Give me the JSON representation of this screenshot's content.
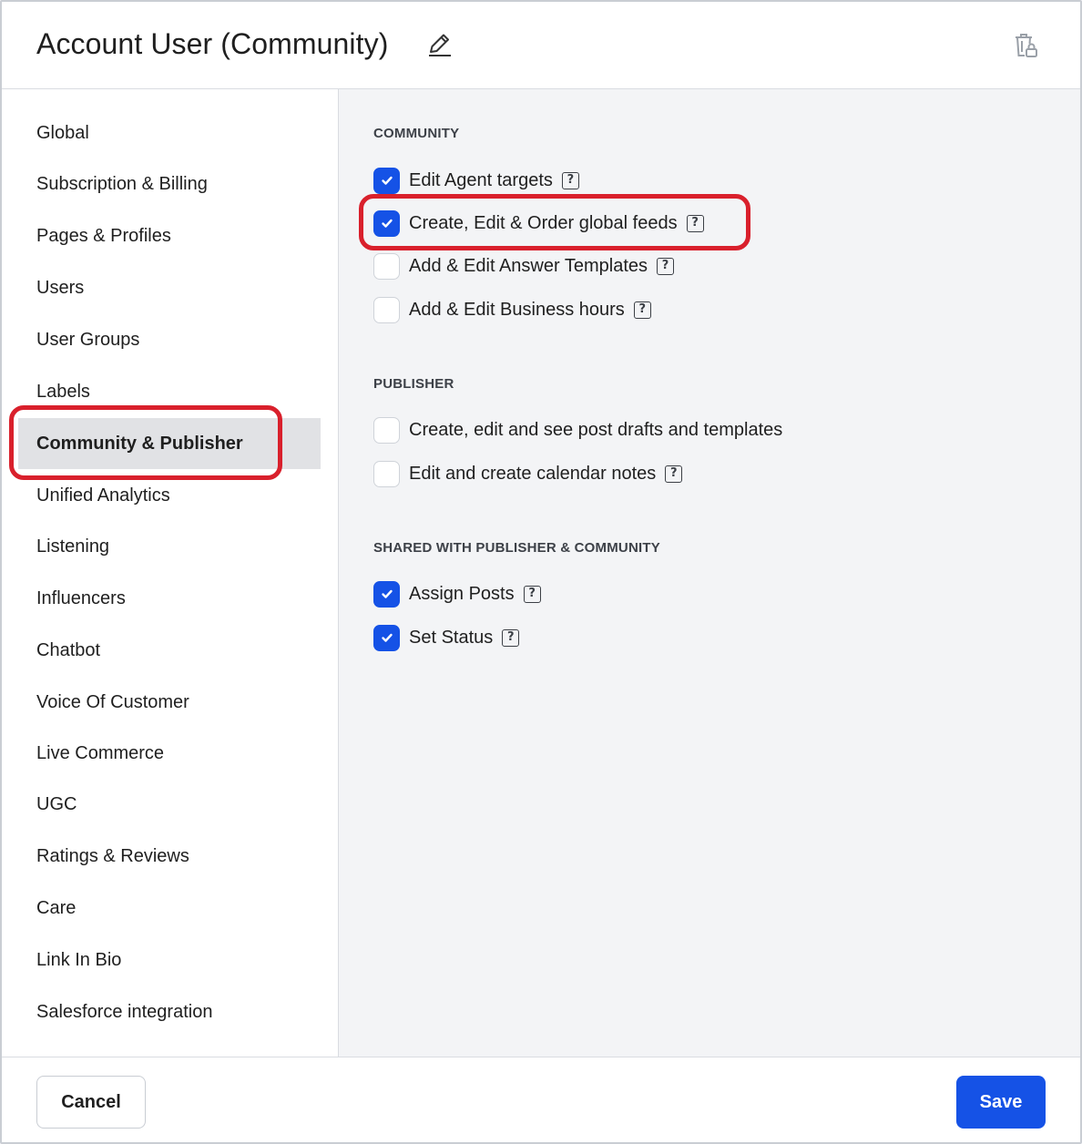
{
  "header": {
    "title": "Account User (Community)",
    "edit_icon": "pencil-icon",
    "delete_icon": "trash-lock-icon"
  },
  "sidebar": {
    "active": "Community & Publisher",
    "items": [
      {
        "label": "Global"
      },
      {
        "label": "Subscription & Billing"
      },
      {
        "label": "Pages & Profiles"
      },
      {
        "label": "Users"
      },
      {
        "label": "User Groups"
      },
      {
        "label": "Labels"
      },
      {
        "label": "Community & Publisher"
      },
      {
        "label": "Unified Analytics"
      },
      {
        "label": "Listening"
      },
      {
        "label": "Influencers"
      },
      {
        "label": "Chatbot"
      },
      {
        "label": "Voice Of Customer"
      },
      {
        "label": "Live Commerce"
      },
      {
        "label": "UGC"
      },
      {
        "label": "Ratings & Reviews"
      },
      {
        "label": "Care"
      },
      {
        "label": "Link In Bio"
      },
      {
        "label": "Salesforce integration"
      }
    ]
  },
  "sections": {
    "community": {
      "title": "COMMUNITY",
      "permissions": [
        {
          "label": "Edit Agent targets",
          "checked": true,
          "help": true
        },
        {
          "label": "Create, Edit & Order global feeds",
          "checked": true,
          "help": true
        },
        {
          "label": "Add & Edit Answer Templates",
          "checked": false,
          "help": true
        },
        {
          "label": "Add & Edit Business hours",
          "checked": false,
          "help": true
        }
      ]
    },
    "publisher": {
      "title": "PUBLISHER",
      "permissions": [
        {
          "label": "Create, edit and see post drafts and templates",
          "checked": false,
          "help": false
        },
        {
          "label": "Edit and create calendar notes",
          "checked": false,
          "help": true
        }
      ]
    },
    "shared": {
      "title": "SHARED WITH PUBLISHER & COMMUNITY",
      "permissions": [
        {
          "label": "Assign Posts",
          "checked": true,
          "help": true
        },
        {
          "label": "Set Status",
          "checked": true,
          "help": true
        }
      ]
    }
  },
  "help_glyph": "?",
  "footer": {
    "cancel_label": "Cancel",
    "save_label": "Save"
  },
  "colors": {
    "accent": "#1552e6",
    "highlight": "#d9202c",
    "active_nav_bg": "#e1e2e5",
    "content_bg": "#f3f4f6"
  }
}
